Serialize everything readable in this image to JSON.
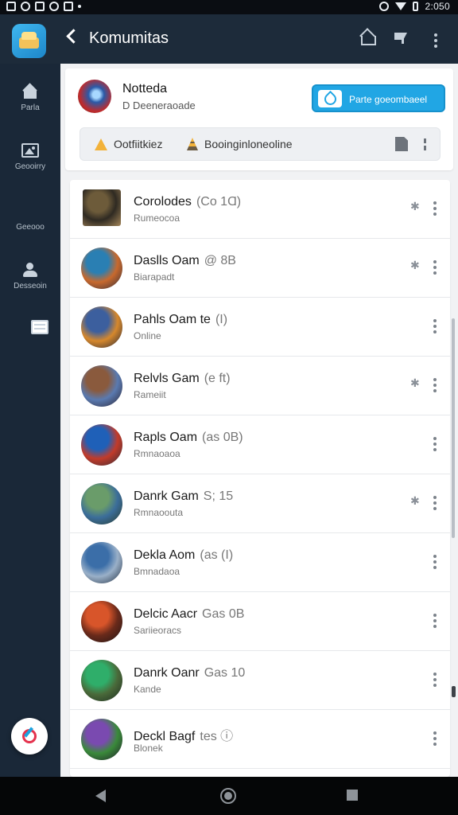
{
  "status_bar": {
    "time": "2:050"
  },
  "header": {
    "title": "Komumitas"
  },
  "rail": {
    "items": [
      {
        "label": "Parla",
        "icon": "home-icon"
      },
      {
        "label": "Geooirry",
        "icon": "image-icon"
      },
      {
        "label": "Geeooo",
        "icon": "list-icon"
      },
      {
        "label": "Desseoin",
        "icon": "users-icon"
      }
    ]
  },
  "group": {
    "name": "Notteda",
    "subtitle": "D Deeneraoade",
    "join_label": "Parte goeombaeel"
  },
  "filters": {
    "left": "Ootfiitkiez",
    "right": "Booinginloneoline"
  },
  "members": [
    {
      "name": "Corolodes",
      "badge": "(Co 1Ɑ)",
      "sub": "Rumeocoa",
      "star": true,
      "avatar": [
        "#6d5b3a",
        "#2f2a22",
        "#a38558"
      ]
    },
    {
      "name": "Daslls Oam",
      "badge": "@ 8B",
      "sub": "Biarapadt",
      "star": true,
      "avatar": [
        "#2a7fb3",
        "#c8692d",
        "#2b2b3a"
      ]
    },
    {
      "name": "Pahls Oam te",
      "badge": "(I)",
      "sub": "Online",
      "star": false,
      "avatar": [
        "#3c5f9e",
        "#d6882c",
        "#1f2236"
      ]
    },
    {
      "name": "Relvls Gam",
      "badge": "(e ft)",
      "sub": "Rameiit",
      "star": true,
      "avatar": [
        "#8a5a3d",
        "#5a7ab0",
        "#2a2230"
      ]
    },
    {
      "name": "Rapls Oam",
      "badge": "(as 0B)",
      "sub": "Rmnaoaoa",
      "star": false,
      "avatar": [
        "#1f60b8",
        "#c23b2a",
        "#2a2a36"
      ]
    },
    {
      "name": "Danrk Gam",
      "badge": "S; 15",
      "sub": "Rmnaoouta",
      "star": true,
      "avatar": [
        "#6a9c6a",
        "#3b6d9a",
        "#283a28"
      ]
    },
    {
      "name": "Dekla Aom",
      "badge": "(as (I)",
      "sub": "Bmnadaoa",
      "star": false,
      "avatar": [
        "#3b6ea8",
        "#9ab0c8",
        "#1e2b3c"
      ]
    },
    {
      "name": "Delcic Aacr",
      "badge": "Gas 0B",
      "sub": "Sariieoracs",
      "star": false,
      "avatar": [
        "#d8552a",
        "#6a2a1a",
        "#1c1416"
      ]
    },
    {
      "name": "Danrk Oanr",
      "badge": "Gas 10",
      "sub": "Kande",
      "star": false,
      "avatar": [
        "#2fae6a",
        "#4a6a3a",
        "#1c2a20"
      ]
    },
    {
      "name": "Deckl Bagf",
      "badge": "tes ⓘ",
      "sub": "Blonek",
      "star": false,
      "avatar": [
        "#7a4ab0",
        "#3a8a3a",
        "#1e1a2a"
      ]
    }
  ]
}
